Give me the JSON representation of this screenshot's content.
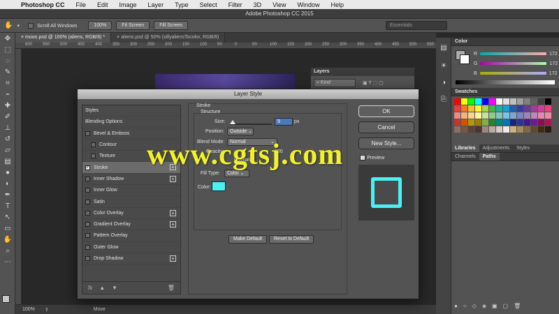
{
  "menubar": {
    "app": "Photoshop CC",
    "items": [
      "File",
      "Edit",
      "Image",
      "Layer",
      "Type",
      "Select",
      "Filter",
      "3D",
      "View",
      "Window",
      "Help"
    ]
  },
  "window": {
    "title": "Adobe Photoshop CC 2015"
  },
  "options": {
    "scroll_all_label": "Scroll All Windows",
    "zoom_value": "100%",
    "fit_screen": "Fit Screen",
    "fill_screen": "Fill Screen",
    "workspace": "Essentials"
  },
  "tabs": [
    {
      "label": "moon.psd @ 100% (aliens, RGB/8) *"
    },
    {
      "label": "aliens.psd @ 50% (sillyaliensTocolor, RGB/8)"
    }
  ],
  "ruler": {
    "ticks": [
      "600",
      "550",
      "500",
      "450",
      "400",
      "350",
      "300",
      "250",
      "200",
      "150",
      "100",
      "50",
      "0",
      "50",
      "100",
      "150",
      "200",
      "250",
      "300",
      "350",
      "400",
      "450",
      "500",
      "550"
    ]
  },
  "status": {
    "zoom": "100%",
    "tool": "Move"
  },
  "layers_panel": {
    "title": "Layers",
    "kind": "Kind"
  },
  "color_panel": {
    "title": "Color",
    "channels": [
      {
        "label": "R",
        "value": "172"
      },
      {
        "label": "G",
        "value": "172"
      },
      {
        "label": "B",
        "value": "172"
      }
    ]
  },
  "swatches_panel": {
    "title": "Swatches"
  },
  "panel_tabs_1": [
    "Libraries",
    "Adjustments",
    "Styles"
  ],
  "panel_tabs_2": [
    "Channels",
    "Paths"
  ],
  "dialog": {
    "title": "Layer Style",
    "list": [
      {
        "label": "Styles",
        "checkbox": false,
        "plus": false
      },
      {
        "label": "Blending Options",
        "checkbox": false,
        "plus": false
      },
      {
        "label": "Bevel & Emboss",
        "checkbox": true,
        "plus": false
      },
      {
        "label": "Contour",
        "checkbox": true,
        "plus": false,
        "indent": true
      },
      {
        "label": "Texture",
        "checkbox": true,
        "plus": false,
        "indent": true
      },
      {
        "label": "Stroke",
        "checkbox": true,
        "checked": true,
        "plus": true,
        "selected": true
      },
      {
        "label": "Inner Shadow",
        "checkbox": true,
        "plus": true
      },
      {
        "label": "Inner Glow",
        "checkbox": true,
        "plus": false
      },
      {
        "label": "Satin",
        "checkbox": true,
        "plus": false
      },
      {
        "label": "Color Overlay",
        "checkbox": true,
        "plus": true
      },
      {
        "label": "Gradient Overlay",
        "checkbox": true,
        "plus": true
      },
      {
        "label": "Pattern Overlay",
        "checkbox": true,
        "plus": false
      },
      {
        "label": "Outer Glow",
        "checkbox": true,
        "plus": false
      },
      {
        "label": "Drop Shadow",
        "checkbox": true,
        "plus": true
      }
    ],
    "stroke": {
      "section": "Stroke",
      "structure": "Structure",
      "size_label": "Size:",
      "size_value": "9",
      "size_unit": "px",
      "position_label": "Position:",
      "position_value": "Outside",
      "blend_label": "Blend Mode:",
      "blend_value": "Normal",
      "opacity_label": "Opacity:",
      "opacity_value": "100",
      "overprint": "Overprint",
      "fill_type_label": "Fill Type:",
      "fill_type_value": "Color",
      "color_label": "Color:",
      "color_hex": "#4bf0f0"
    },
    "make_default": "Make Default",
    "reset_default": "Reset to Default",
    "ok": "OK",
    "cancel": "Cancel",
    "new_style": "New Style...",
    "preview_label": "Preview"
  },
  "watermark": "www.cgtsj.com"
}
